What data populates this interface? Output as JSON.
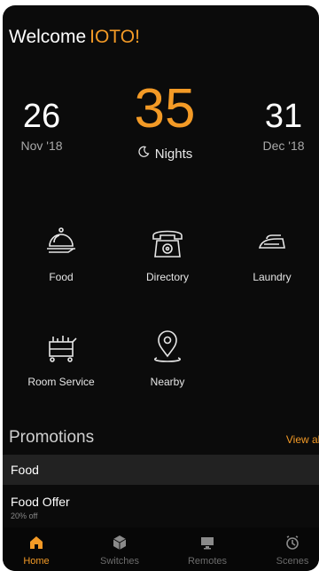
{
  "header": {
    "welcome_text": "Welcome",
    "guest_name": "IOTO!"
  },
  "stay": {
    "check_in": {
      "day": "26",
      "month": "Nov '18"
    },
    "nights": {
      "count": "35",
      "label": "Nights"
    },
    "check_out": {
      "day": "31",
      "month": "Dec '18"
    }
  },
  "services": [
    {
      "label": "Food",
      "icon": "food-cloche-icon"
    },
    {
      "label": "Directory",
      "icon": "telephone-icon"
    },
    {
      "label": "Laundry",
      "icon": "iron-icon"
    },
    {
      "label": "Room Service",
      "icon": "room-service-cart-icon"
    },
    {
      "label": "Nearby",
      "icon": "map-pin-icon"
    }
  ],
  "promotions": {
    "title": "Promotions",
    "view_all": "View all",
    "category": "Food",
    "offer": {
      "title": "Food Offer",
      "subtitle": "20% off"
    }
  },
  "tabs": [
    {
      "label": "Home",
      "icon": "home-icon",
      "active": true
    },
    {
      "label": "Switches",
      "icon": "cube-icon",
      "active": false
    },
    {
      "label": "Remotes",
      "icon": "monitor-icon",
      "active": false
    },
    {
      "label": "Scenes",
      "icon": "clock-icon",
      "active": false
    }
  ],
  "colors": {
    "accent": "#f39a26",
    "background": "#0b0b0b",
    "muted": "#a9a9a9"
  }
}
